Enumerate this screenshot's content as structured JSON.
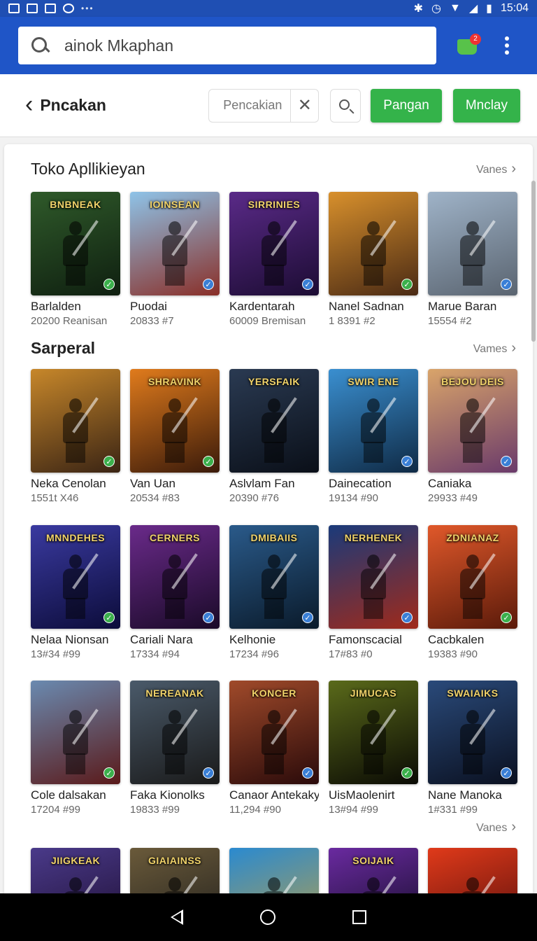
{
  "status_bar": {
    "time": "15:04"
  },
  "app_bar": {
    "search_value": "ainok Mkaphan",
    "cart_badge": "2"
  },
  "toolbar": {
    "back_label": "Pncakan",
    "filter_value": "Pencakian",
    "button_1": "Pangan",
    "button_2": "Mnclay"
  },
  "sections": [
    {
      "title": "Toko Apllikieyan",
      "more": "Vanes",
      "cards": [
        {
          "name": "Barlalden",
          "meta": "20200 Reanisan",
          "art": "BNBNEAK",
          "verified": "green"
        },
        {
          "name": "Puodai",
          "meta": "20833 #7",
          "art": "IOINSEAN",
          "verified": "blue"
        },
        {
          "name": "Kardentarah",
          "meta": "60009 Bremisan",
          "art": "SIRRINIES",
          "verified": "blue"
        },
        {
          "name": "Nanel Sadnan",
          "meta": "1 8391 #2",
          "art": "",
          "verified": "green"
        },
        {
          "name": "Marue Baran",
          "meta": "15554 #2",
          "art": "",
          "verified": "blue"
        }
      ]
    },
    {
      "title": "Sarperal",
      "more": "Vames",
      "rows": [
        [
          {
            "name": "Neka Cenolan",
            "meta": "1551t X46",
            "art": "",
            "verified": "green"
          },
          {
            "name": "Van Uan",
            "meta": "20534 #83",
            "art": "SHRAVINK",
            "verified": "green"
          },
          {
            "name": "Aslvlam Fan",
            "meta": "20390 #76",
            "art": "YERSFAIK",
            "verified": ""
          },
          {
            "name": "Dainecation",
            "meta": "19134 #90",
            "art": "SWIR ENE",
            "verified": "blue"
          },
          {
            "name": "Caniaka",
            "meta": "29933 #49",
            "art": "BEJOU DEIS",
            "verified": "blue"
          }
        ],
        [
          {
            "name": "Nelaa Nionsan",
            "meta": "13#34 #99",
            "art": "MNNDEHES",
            "verified": "green"
          },
          {
            "name": "Cariali Nara",
            "meta": "17334 #94",
            "art": "CERNERS",
            "verified": "blue"
          },
          {
            "name": "Kelhonie",
            "meta": "17234 #96",
            "art": "DMIBAIIS",
            "verified": "blue"
          },
          {
            "name": "Famonscacial",
            "meta": "17#83 #0",
            "art": "NERHENEK",
            "verified": "blue"
          },
          {
            "name": "Cacbkalen",
            "meta": "19383 #90",
            "art": "ZDNIANAZ",
            "verified": "green"
          }
        ],
        [
          {
            "name": "Cole dalsakan",
            "meta": "17204 #99",
            "art": "",
            "verified": "green"
          },
          {
            "name": "Faka Kionolks",
            "meta": "19833 #99",
            "art": "NEREANAK",
            "verified": "blue"
          },
          {
            "name": "Canaor Antekaky",
            "meta": "11,294 #90",
            "art": "KONCER",
            "verified": "blue"
          },
          {
            "name": "UisMaolenirt",
            "meta": "13#94 #99",
            "art": "JIMUCAS",
            "verified": "green"
          },
          {
            "name": "Nane Manoka",
            "meta": "1#331 #99",
            "art": "SWAIAIKS",
            "verified": "blue"
          }
        ]
      ],
      "more_bottom": "Vanes"
    }
  ],
  "partial_row": [
    {
      "art": "JIIGKEAK"
    },
    {
      "art": "GIAIAINSS"
    },
    {
      "art": ""
    },
    {
      "art": "SOIJAIK"
    },
    {
      "art": ""
    }
  ],
  "palette": {
    "appbar": "#1f55c7",
    "statusbar": "#1f4fb3",
    "green_button": "#34b34a",
    "verified_green": "#3bb04c",
    "verified_blue": "#3a7fd6"
  }
}
